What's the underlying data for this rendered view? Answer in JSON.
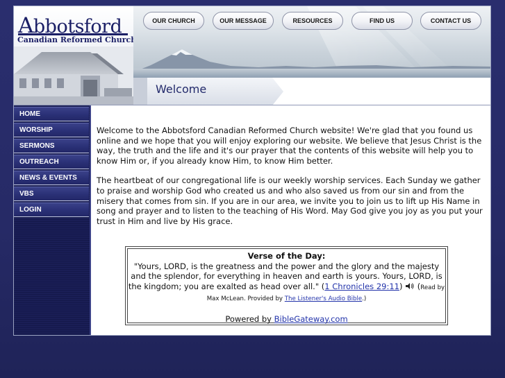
{
  "logo": {
    "wordmark_initial": "A",
    "wordmark_rest": "bbotsford",
    "subtitle": "Canadian Reformed Church"
  },
  "nav": {
    "items": [
      {
        "label": "OUR CHURCH"
      },
      {
        "label": "OUR MESSAGE"
      },
      {
        "label": "RESOURCES"
      },
      {
        "label": "FIND US"
      },
      {
        "label": "CONTACT US"
      }
    ]
  },
  "page": {
    "title": "Welcome"
  },
  "sidebar": {
    "items": [
      {
        "label": "HOME"
      },
      {
        "label": "WORSHIP"
      },
      {
        "label": "SERMONS"
      },
      {
        "label": "OUTREACH"
      },
      {
        "label": "NEWS & EVENTS"
      },
      {
        "label": "VBS"
      },
      {
        "label": "LOGIN"
      }
    ]
  },
  "content": {
    "paragraph1": "Welcome to the Abbotsford Canadian Reformed Church website! We're glad that you found us online and we hope that you will enjoy exploring our website. We believe that Jesus Christ is the way, the truth and the life and it's our prayer that the contents of this website will help you to know Him or, if you already know Him, to know Him better.",
    "paragraph2": "The heartbeat of our congregational life is our weekly worship services. Each Sunday we gather to praise and worship God who created us and who also saved us from our sin and from the misery that comes from sin. If you are in our area, we invite you to join us to lift up His Name in song and prayer and to listen to the teaching of His Word. May God give you joy as you put your trust in Him and live by His grace."
  },
  "votd": {
    "title": "Verse of the Day:",
    "verse": "\"Yours, LORD, is the greatness and the power and the glory and the majesty and the splendor, for everything in heaven and earth is yours. Yours, LORD, is the kingdom; you are exalted as head over all.\"",
    "open_paren": "(",
    "reference": "1 Chronicles 29:11",
    "close_paren": ")",
    "read_open": "(",
    "read_prefix": "Read by Max McLean. Provided by ",
    "read_link": "The Listener's Audio Bible",
    "read_suffix": ".)",
    "powered_prefix": "Powered by ",
    "powered_link": "BibleGateway.com"
  },
  "colors": {
    "background": "#2a2e6e",
    "sidebar": "#2a3076",
    "title": "#232a6b",
    "link": "#2233aa"
  }
}
